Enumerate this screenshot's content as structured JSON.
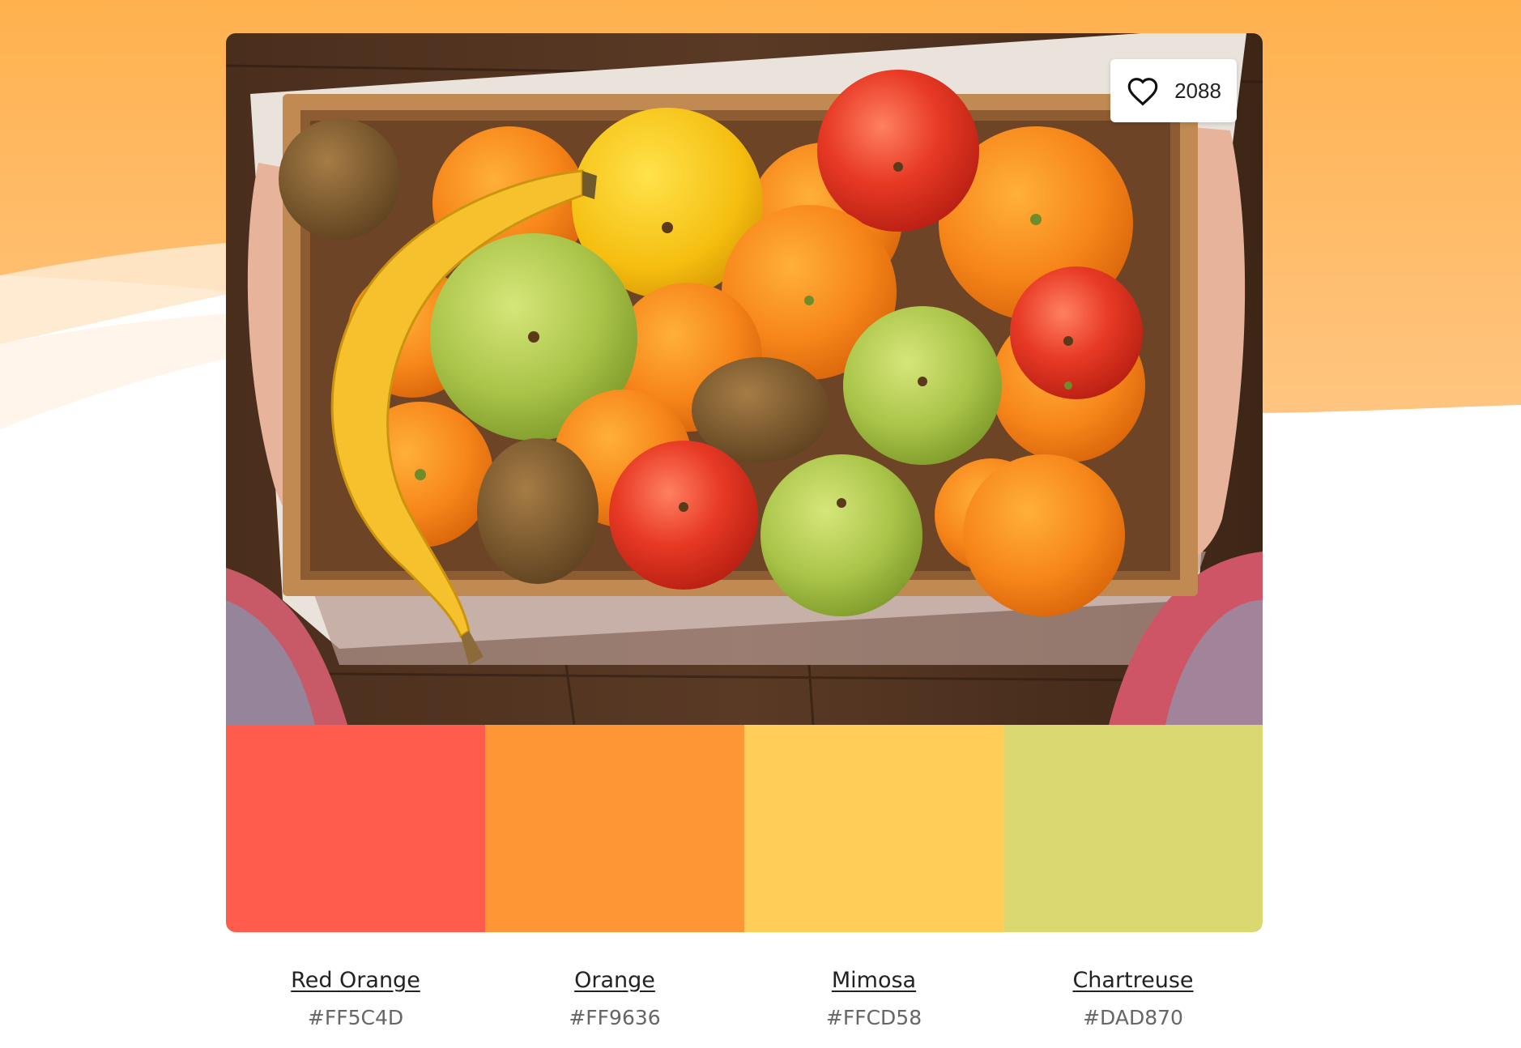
{
  "palette": {
    "likes": "2088",
    "colors": [
      {
        "name": "Red Orange",
        "hex": "#FF5C4D"
      },
      {
        "name": "Orange",
        "hex": "#FF9636"
      },
      {
        "name": "Mimosa",
        "hex": "#FFCD58"
      },
      {
        "name": "Chartreuse",
        "hex": "#DAD870"
      }
    ]
  },
  "theme": {
    "background_orange": "#FFB14E",
    "background_light": "#FFE3C2"
  },
  "image": {
    "subject": "wooden crate of fruit: apples, oranges, kiwis, banana"
  },
  "icons": {
    "like": "heart-icon"
  }
}
